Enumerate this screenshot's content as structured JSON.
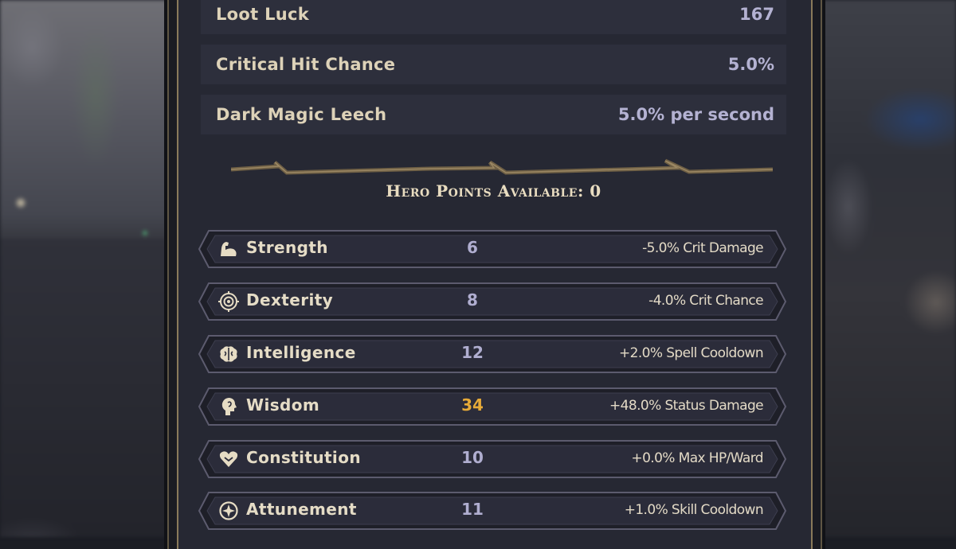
{
  "info_rows": [
    {
      "label": "Loot Luck",
      "value": "167"
    },
    {
      "label": "Critical Hit Chance",
      "value": "5.0%"
    },
    {
      "label": "Dark Magic Leech",
      "value": "5.0% per second"
    }
  ],
  "hero_points_label": "Hero Points Available: 0",
  "stats": [
    {
      "name": "Strength",
      "value": "6",
      "effect": "-5.0% Crit Damage",
      "icon": "flexed-arm-icon"
    },
    {
      "name": "Dexterity",
      "value": "8",
      "effect": "-4.0% Crit Chance",
      "icon": "target-icon"
    },
    {
      "name": "Intelligence",
      "value": "12",
      "effect": "+2.0% Spell Cooldown",
      "icon": "brain-icon"
    },
    {
      "name": "Wisdom",
      "value": "34",
      "effect": "+48.0% Status Damage",
      "icon": "head-profile-icon"
    },
    {
      "name": "Constitution",
      "value": "10",
      "effect": "+0.0% Max HP/Ward",
      "icon": "heart-icon"
    },
    {
      "name": "Attunement",
      "value": "11",
      "effect": "+1.0% Skill Cooldown",
      "icon": "mystic-circle-icon"
    }
  ],
  "colors": {
    "highlight_value": "#e6aa38",
    "normal_value": "#b0aed0",
    "label": "#ddd2b8"
  }
}
